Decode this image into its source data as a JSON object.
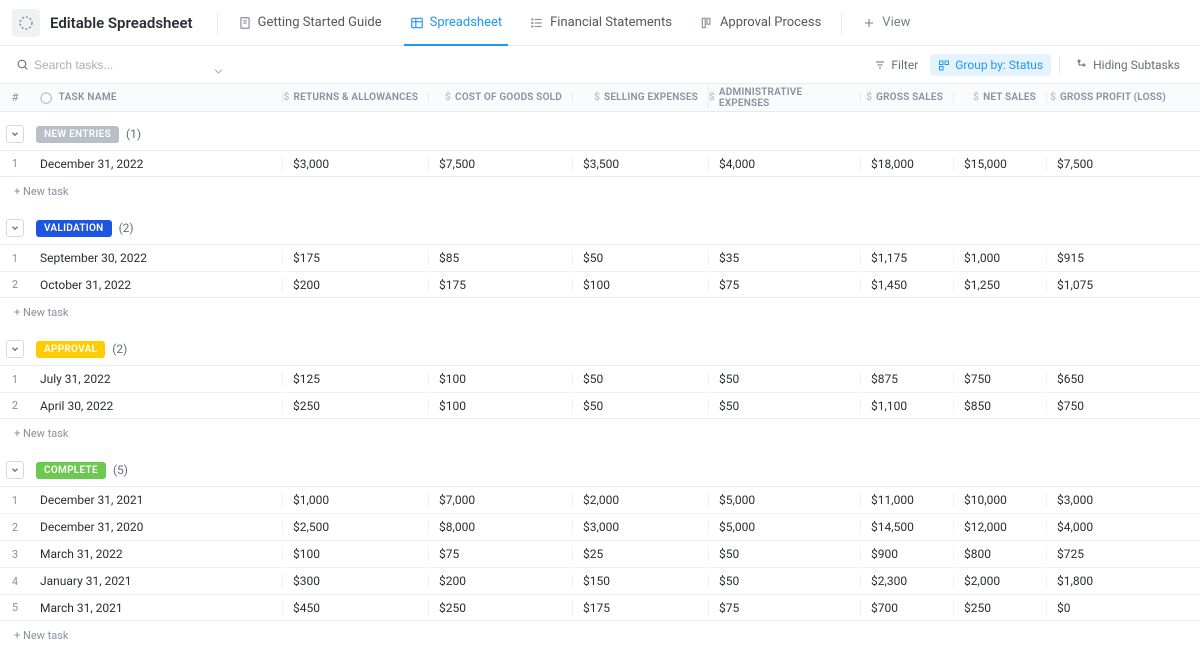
{
  "header": {
    "title": "Editable Spreadsheet",
    "tabs": [
      {
        "label": "Getting Started Guide"
      },
      {
        "label": "Spreadsheet"
      },
      {
        "label": "Financial Statements"
      },
      {
        "label": "Approval Process"
      }
    ],
    "add_view": "View"
  },
  "toolbar": {
    "search_placeholder": "Search tasks...",
    "filter": "Filter",
    "group_by": "Group by: Status",
    "hiding": "Hiding Subtasks"
  },
  "columns": {
    "num": "#",
    "name": "TASK NAME",
    "ra": "RETURNS & ALLOWANCES",
    "cogs": "COST OF GOODS SOLD",
    "se": "SELLING EXPENSES",
    "ae": "ADMINISTRATIVE EXPENSES",
    "gs": "GROSS SALES",
    "ns": "NET SALES",
    "gp": "GROSS PROFIT (LOSS)"
  },
  "groups": [
    {
      "label": "NEW ENTRIES",
      "badge_class": "badge-new",
      "count": "(1)",
      "rows": [
        {
          "num": "1",
          "name": "December 31, 2022",
          "ra": "$3,000",
          "cogs": "$7,500",
          "se": "$3,500",
          "ae": "$4,000",
          "gs": "$18,000",
          "ns": "$15,000",
          "gp": "$7,500"
        }
      ]
    },
    {
      "label": "VALIDATION",
      "badge_class": "badge-validation",
      "count": "(2)",
      "rows": [
        {
          "num": "1",
          "name": "September 30, 2022",
          "ra": "$175",
          "cogs": "$85",
          "se": "$50",
          "ae": "$35",
          "gs": "$1,175",
          "ns": "$1,000",
          "gp": "$915"
        },
        {
          "num": "2",
          "name": "October 31, 2022",
          "ra": "$200",
          "cogs": "$175",
          "se": "$100",
          "ae": "$75",
          "gs": "$1,450",
          "ns": "$1,250",
          "gp": "$1,075"
        }
      ]
    },
    {
      "label": "APPROVAL",
      "badge_class": "badge-approval",
      "count": "(2)",
      "rows": [
        {
          "num": "1",
          "name": "July 31, 2022",
          "ra": "$125",
          "cogs": "$100",
          "se": "$50",
          "ae": "$50",
          "gs": "$875",
          "ns": "$750",
          "gp": "$650"
        },
        {
          "num": "2",
          "name": "April 30, 2022",
          "ra": "$250",
          "cogs": "$100",
          "se": "$50",
          "ae": "$50",
          "gs": "$1,100",
          "ns": "$850",
          "gp": "$750"
        }
      ]
    },
    {
      "label": "COMPLETE",
      "badge_class": "badge-complete",
      "count": "(5)",
      "rows": [
        {
          "num": "1",
          "name": "December 31, 2021",
          "ra": "$1,000",
          "cogs": "$7,000",
          "se": "$2,000",
          "ae": "$5,000",
          "gs": "$11,000",
          "ns": "$10,000",
          "gp": "$3,000"
        },
        {
          "num": "2",
          "name": "December 31, 2020",
          "ra": "$2,500",
          "cogs": "$8,000",
          "se": "$3,000",
          "ae": "$5,000",
          "gs": "$14,500",
          "ns": "$12,000",
          "gp": "$4,000"
        },
        {
          "num": "3",
          "name": "March 31, 2022",
          "ra": "$100",
          "cogs": "$75",
          "se": "$25",
          "ae": "$50",
          "gs": "$900",
          "ns": "$800",
          "gp": "$725"
        },
        {
          "num": "4",
          "name": "January 31, 2021",
          "ra": "$300",
          "cogs": "$200",
          "se": "$150",
          "ae": "$50",
          "gs": "$2,300",
          "ns": "$2,000",
          "gp": "$1,800"
        },
        {
          "num": "5",
          "name": "March 31, 2021",
          "ra": "$450",
          "cogs": "$250",
          "se": "$175",
          "ae": "$75",
          "gs": "$700",
          "ns": "$250",
          "gp": "$0"
        }
      ]
    }
  ],
  "new_task": "+ New task"
}
